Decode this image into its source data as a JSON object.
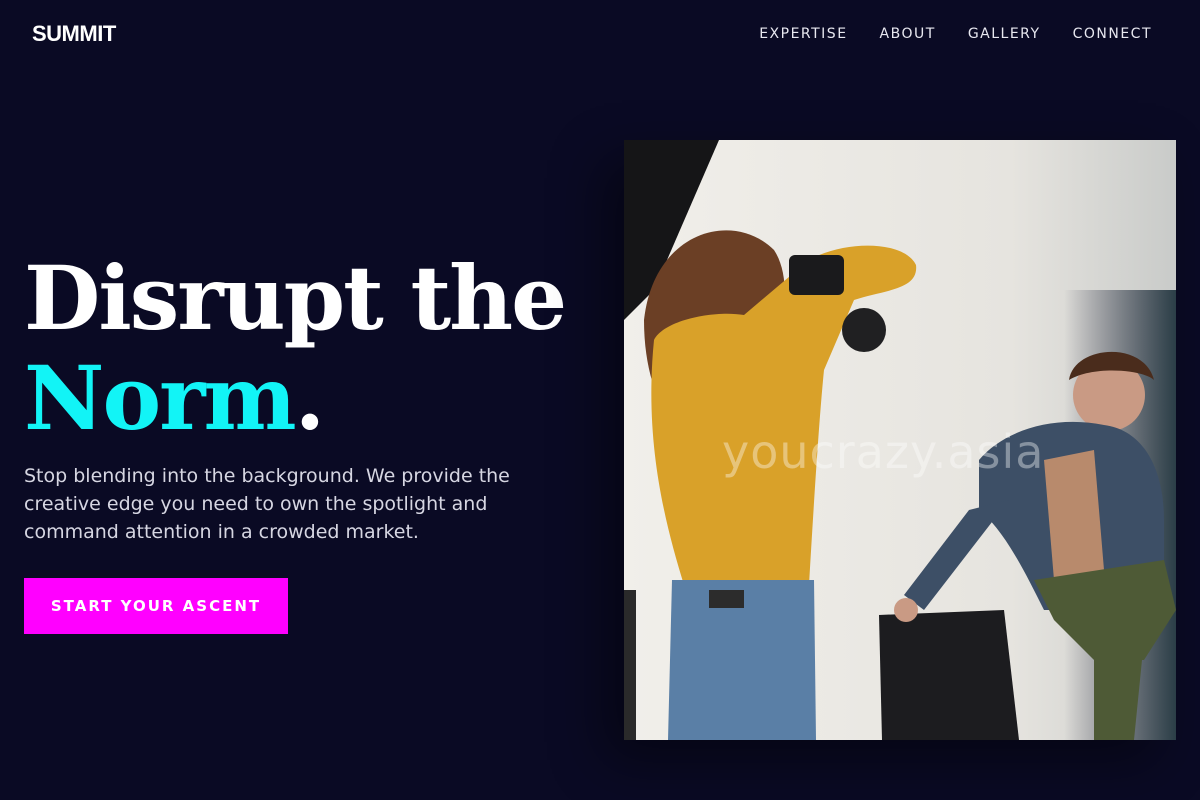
{
  "header": {
    "logo": "SUMMIT",
    "nav": [
      "EXPERTISE",
      "ABOUT",
      "GALLERY",
      "CONNECT"
    ]
  },
  "hero": {
    "headline_line1": "Disrupt the",
    "headline_accent": "Norm",
    "headline_period": ".",
    "subtitle": "Stop blending into the background. We provide the creative edge you need to own the spotlight and command attention in a crowded market.",
    "cta_label": "START YOUR ASCENT",
    "image_watermark": "youcrazy.asia"
  },
  "colors": {
    "background": "#0a0a24",
    "accent_cyan": "#12f4f6",
    "cta_magenta": "#ff00ff"
  }
}
